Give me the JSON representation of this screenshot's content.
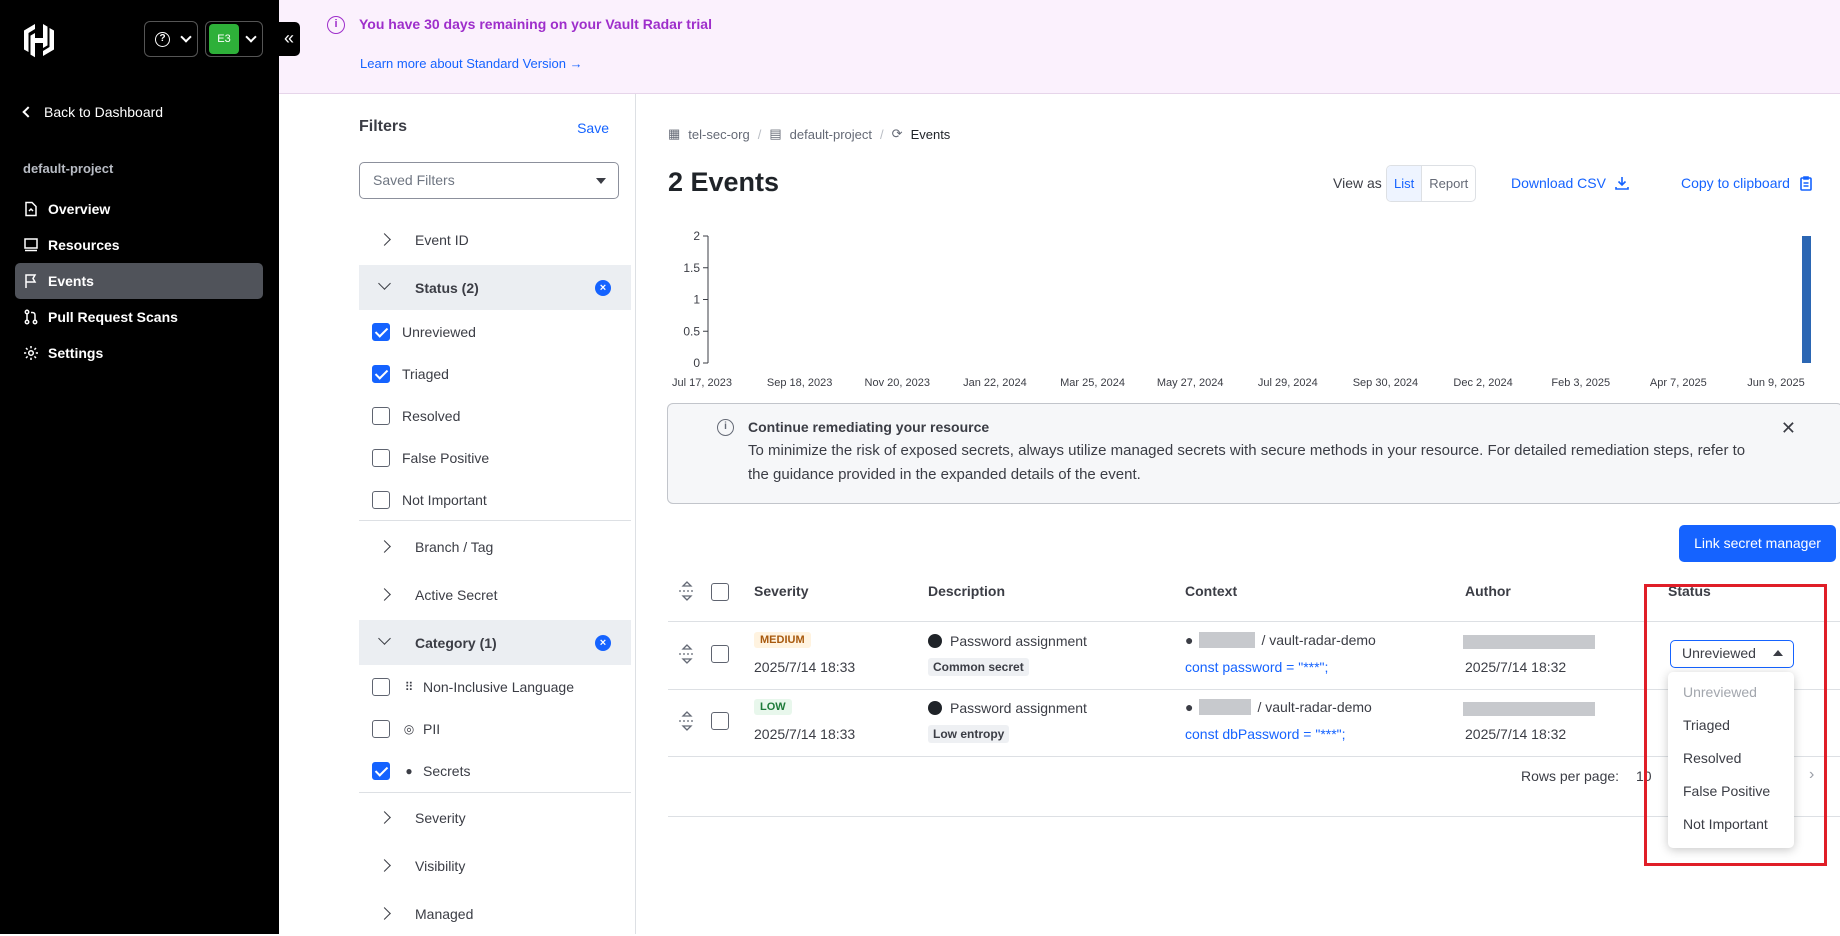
{
  "sidebar": {
    "back": "Back to Dashboard",
    "project": "default-project",
    "org_initials": "E3",
    "items": [
      {
        "label": "Overview",
        "icon": "overview-icon"
      },
      {
        "label": "Resources",
        "icon": "resources-icon"
      },
      {
        "label": "Events",
        "icon": "flag-icon",
        "active": true
      },
      {
        "label": "Pull Request Scans",
        "icon": "pull-request-icon"
      },
      {
        "label": "Settings",
        "icon": "gear-icon"
      }
    ]
  },
  "banner": {
    "message": "You have 30 days remaining on your Vault Radar trial",
    "link": "Learn more about Standard Version"
  },
  "filters": {
    "title": "Filters",
    "save": "Save",
    "saved_placeholder": "Saved Filters",
    "sections": {
      "event_id": "Event ID",
      "status": "Status (2)",
      "branch": "Branch / Tag",
      "active_secret": "Active Secret",
      "category": "Category (1)",
      "severity": "Severity",
      "visibility": "Visibility",
      "managed": "Managed"
    },
    "status_options": [
      {
        "label": "Unreviewed",
        "checked": true
      },
      {
        "label": "Triaged",
        "checked": true
      },
      {
        "label": "Resolved",
        "checked": false
      },
      {
        "label": "False Positive",
        "checked": false
      },
      {
        "label": "Not Important",
        "checked": false
      }
    ],
    "category_options": [
      {
        "label": "Non-Inclusive Language",
        "checked": false,
        "icon": "grid-icon"
      },
      {
        "label": "PII",
        "checked": false,
        "icon": "fingerprint-icon"
      },
      {
        "label": "Secrets",
        "checked": true,
        "icon": "secret-icon"
      }
    ]
  },
  "breadcrumb": [
    "tel-sec-org",
    "default-project",
    "Events"
  ],
  "page_title": "2 Events",
  "view_as": {
    "label": "View as",
    "list": "List",
    "report": "Report",
    "selected": "List"
  },
  "actions": {
    "download_csv": "Download CSV",
    "copy_clipboard": "Copy to clipboard"
  },
  "chart_data": {
    "type": "bar",
    "x": [
      "Jul 17, 2023",
      "Sep 18, 2023",
      "Nov 20, 2023",
      "Jan 22, 2024",
      "Mar 25, 2024",
      "May 27, 2024",
      "Jul 29, 2024",
      "Sep 30, 2024",
      "Dec 2, 2024",
      "Feb 3, 2025",
      "Apr 7, 2025",
      "Jun 9, 2025"
    ],
    "bars": [
      {
        "date": "2025-07-14",
        "value": 2
      }
    ],
    "y_ticks": [
      "0",
      "0.5",
      "1",
      "1.5",
      "2"
    ],
    "ylim": [
      0,
      2
    ],
    "xlim": [
      "2023-07-17",
      "2025-07-14"
    ],
    "color": "#2b66b3",
    "grid": false
  },
  "callout": {
    "title": "Continue remediating your resource",
    "body": "To minimize the risk of exposed secrets, always utilize managed secrets with secure methods in your resource. For detailed remediation steps, refer to the guidance provided in the expanded details of the event."
  },
  "link_secret_manager": "Link secret manager",
  "table": {
    "columns": [
      "Severity",
      "Description",
      "Context",
      "Author",
      "Status"
    ],
    "rows": [
      {
        "severity": "MEDIUM",
        "date": "2025/7/14 18:33",
        "description": "Password assignment",
        "tag": "Common secret",
        "repo": "/ vault-radar-demo",
        "code": "const password = \"***\";",
        "author_date": "2025/7/14 18:32"
      },
      {
        "severity": "LOW",
        "date": "2025/7/14 18:33",
        "description": "Password assignment",
        "tag": "Low entropy",
        "repo": "/ vault-radar-demo",
        "code": "const dbPassword = \"***\";",
        "author_date": "2025/7/14 18:32"
      }
    ]
  },
  "pagination": {
    "rows_per_page": "Rows per page:",
    "value": "10"
  },
  "status_dropdown": {
    "value": "Unreviewed",
    "options": [
      "Unreviewed",
      "Triaged",
      "Resolved",
      "False Positive",
      "Not Important"
    ]
  },
  "colors": {
    "accent": "#1563ff",
    "highlight": "#e01e28",
    "banner": "#9e2ecb"
  }
}
